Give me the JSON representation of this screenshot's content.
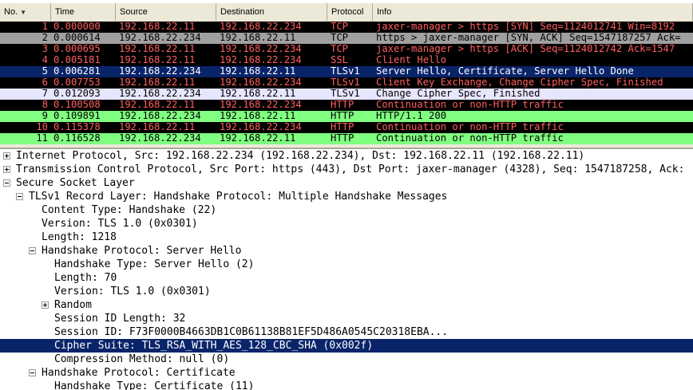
{
  "packet_list": {
    "columns": [
      {
        "key": "no",
        "label": "No.",
        "sorted": true
      },
      {
        "key": "time",
        "label": "Time"
      },
      {
        "key": "source",
        "label": "Source"
      },
      {
        "key": "destination",
        "label": "Destination"
      },
      {
        "key": "protocol",
        "label": "Protocol"
      },
      {
        "key": "info",
        "label": "Info"
      }
    ],
    "sort_icon": "sort-down-icon",
    "rows": [
      {
        "no": "1",
        "time": "0.000000",
        "source": "192.168.22.11",
        "destination": "192.168.22.234",
        "protocol": "TCP",
        "info": "jaxer-manager > https [SYN] Seq=1124012741 Win=8192",
        "bg": "#000000",
        "fg": "#ff5f5f"
      },
      {
        "no": "2",
        "time": "0.000614",
        "source": "192.168.22.234",
        "destination": "192.168.22.11",
        "protocol": "TCP",
        "info": "https > jaxer-manager [SYN, ACK] Seq=1547187257 Ack=",
        "bg": "#a0a0a0",
        "fg": "#000000"
      },
      {
        "no": "3",
        "time": "0.000695",
        "source": "192.168.22.11",
        "destination": "192.168.22.234",
        "protocol": "TCP",
        "info": "jaxer-manager > https [ACK] Seq=1124012742 Ack=1547",
        "bg": "#000000",
        "fg": "#ff5f5f"
      },
      {
        "no": "4",
        "time": "0.005181",
        "source": "192.168.22.11",
        "destination": "192.168.22.234",
        "protocol": "SSL",
        "info": "Client Hello",
        "bg": "#000000",
        "fg": "#ff5f5f"
      },
      {
        "no": "5",
        "time": "0.006281",
        "source": "192.168.22.234",
        "destination": "192.168.22.11",
        "protocol": "TLSv1",
        "info": "Server Hello, Certificate, Server Hello Done",
        "bg": "#0a246a",
        "fg": "#ffffff"
      },
      {
        "no": "6",
        "time": "0.007753",
        "source": "192.168.22.11",
        "destination": "192.168.22.234",
        "protocol": "TLSv1",
        "info": "Client Key Exchange, Change Cipher Spec, Finished",
        "bg": "#000000",
        "fg": "#ff5f5f"
      },
      {
        "no": "7",
        "time": "0.012093",
        "source": "192.168.22.234",
        "destination": "192.168.22.11",
        "protocol": "TLSv1",
        "info": "Change Cipher Spec, Finished",
        "bg": "#e7e6ff",
        "fg": "#000000"
      },
      {
        "no": "8",
        "time": "0.100508",
        "source": "192.168.22.11",
        "destination": "192.168.22.234",
        "protocol": "HTTP",
        "info": "Continuation or non-HTTP traffic",
        "bg": "#000000",
        "fg": "#ff5f5f"
      },
      {
        "no": "9",
        "time": "0.109891",
        "source": "192.168.22.234",
        "destination": "192.168.22.11",
        "protocol": "HTTP",
        "info": "HTTP/1.1 200",
        "bg": "#80ff80",
        "fg": "#000000"
      },
      {
        "no": "10",
        "time": "0.115378",
        "source": "192.168.22.11",
        "destination": "192.168.22.234",
        "protocol": "HTTP",
        "info": "Continuation or non-HTTP traffic",
        "bg": "#000000",
        "fg": "#ff5f5f"
      },
      {
        "no": "11",
        "time": "0.116528",
        "source": "192.168.22.234",
        "destination": "192.168.22.11",
        "protocol": "HTTP",
        "info": "Continuation or non-HTTP traffic",
        "bg": "#80ff80",
        "fg": "#000000"
      }
    ]
  },
  "detail_tree": {
    "rows": [
      {
        "text": "Internet Protocol, Src: 192.168.22.234 (192.168.22.234), Dst: 192.168.22.11 (192.168.22.11)",
        "level": 0,
        "toggle": "plus"
      },
      {
        "text": "Transmission Control Protocol, Src Port: https (443), Dst Port: jaxer-manager (4328), Seq: 1547187258, Ack:",
        "level": 0,
        "toggle": "plus"
      },
      {
        "text": "Secure Socket Layer",
        "level": 0,
        "toggle": "minus"
      },
      {
        "text": "TLSv1 Record Layer: Handshake Protocol: Multiple Handshake Messages",
        "level": 1,
        "toggle": "minus"
      },
      {
        "text": "Content Type: Handshake (22)",
        "level": 2,
        "toggle": "none"
      },
      {
        "text": "Version: TLS 1.0 (0x0301)",
        "level": 2,
        "toggle": "none"
      },
      {
        "text": "Length: 1218",
        "level": 2,
        "toggle": "none"
      },
      {
        "text": "Handshake Protocol: Server Hello",
        "level": 2,
        "toggle": "minus"
      },
      {
        "text": "Handshake Type: Server Hello (2)",
        "level": 3,
        "toggle": "none"
      },
      {
        "text": "Length: 70",
        "level": 3,
        "toggle": "none"
      },
      {
        "text": "Version: TLS 1.0 (0x0301)",
        "level": 3,
        "toggle": "none"
      },
      {
        "text": "Random",
        "level": 3,
        "toggle": "plus"
      },
      {
        "text": "Session ID Length: 32",
        "level": 3,
        "toggle": "none"
      },
      {
        "text": "Session ID: F73F0000B4663DB1C0B61138B81EF5D486A0545C20318EBA...",
        "level": 3,
        "toggle": "none"
      },
      {
        "text": "Cipher Suite: TLS_RSA_WITH_AES_128_CBC_SHA (0x002f)",
        "level": 3,
        "toggle": "none",
        "selected": true
      },
      {
        "text": "Compression Method: null (0)",
        "level": 3,
        "toggle": "none"
      },
      {
        "text": "Handshake Protocol: Certificate",
        "level": 2,
        "toggle": "minus"
      },
      {
        "text": "Handshake Type: Certificate (11)",
        "level": 3,
        "toggle": "none"
      }
    ]
  }
}
